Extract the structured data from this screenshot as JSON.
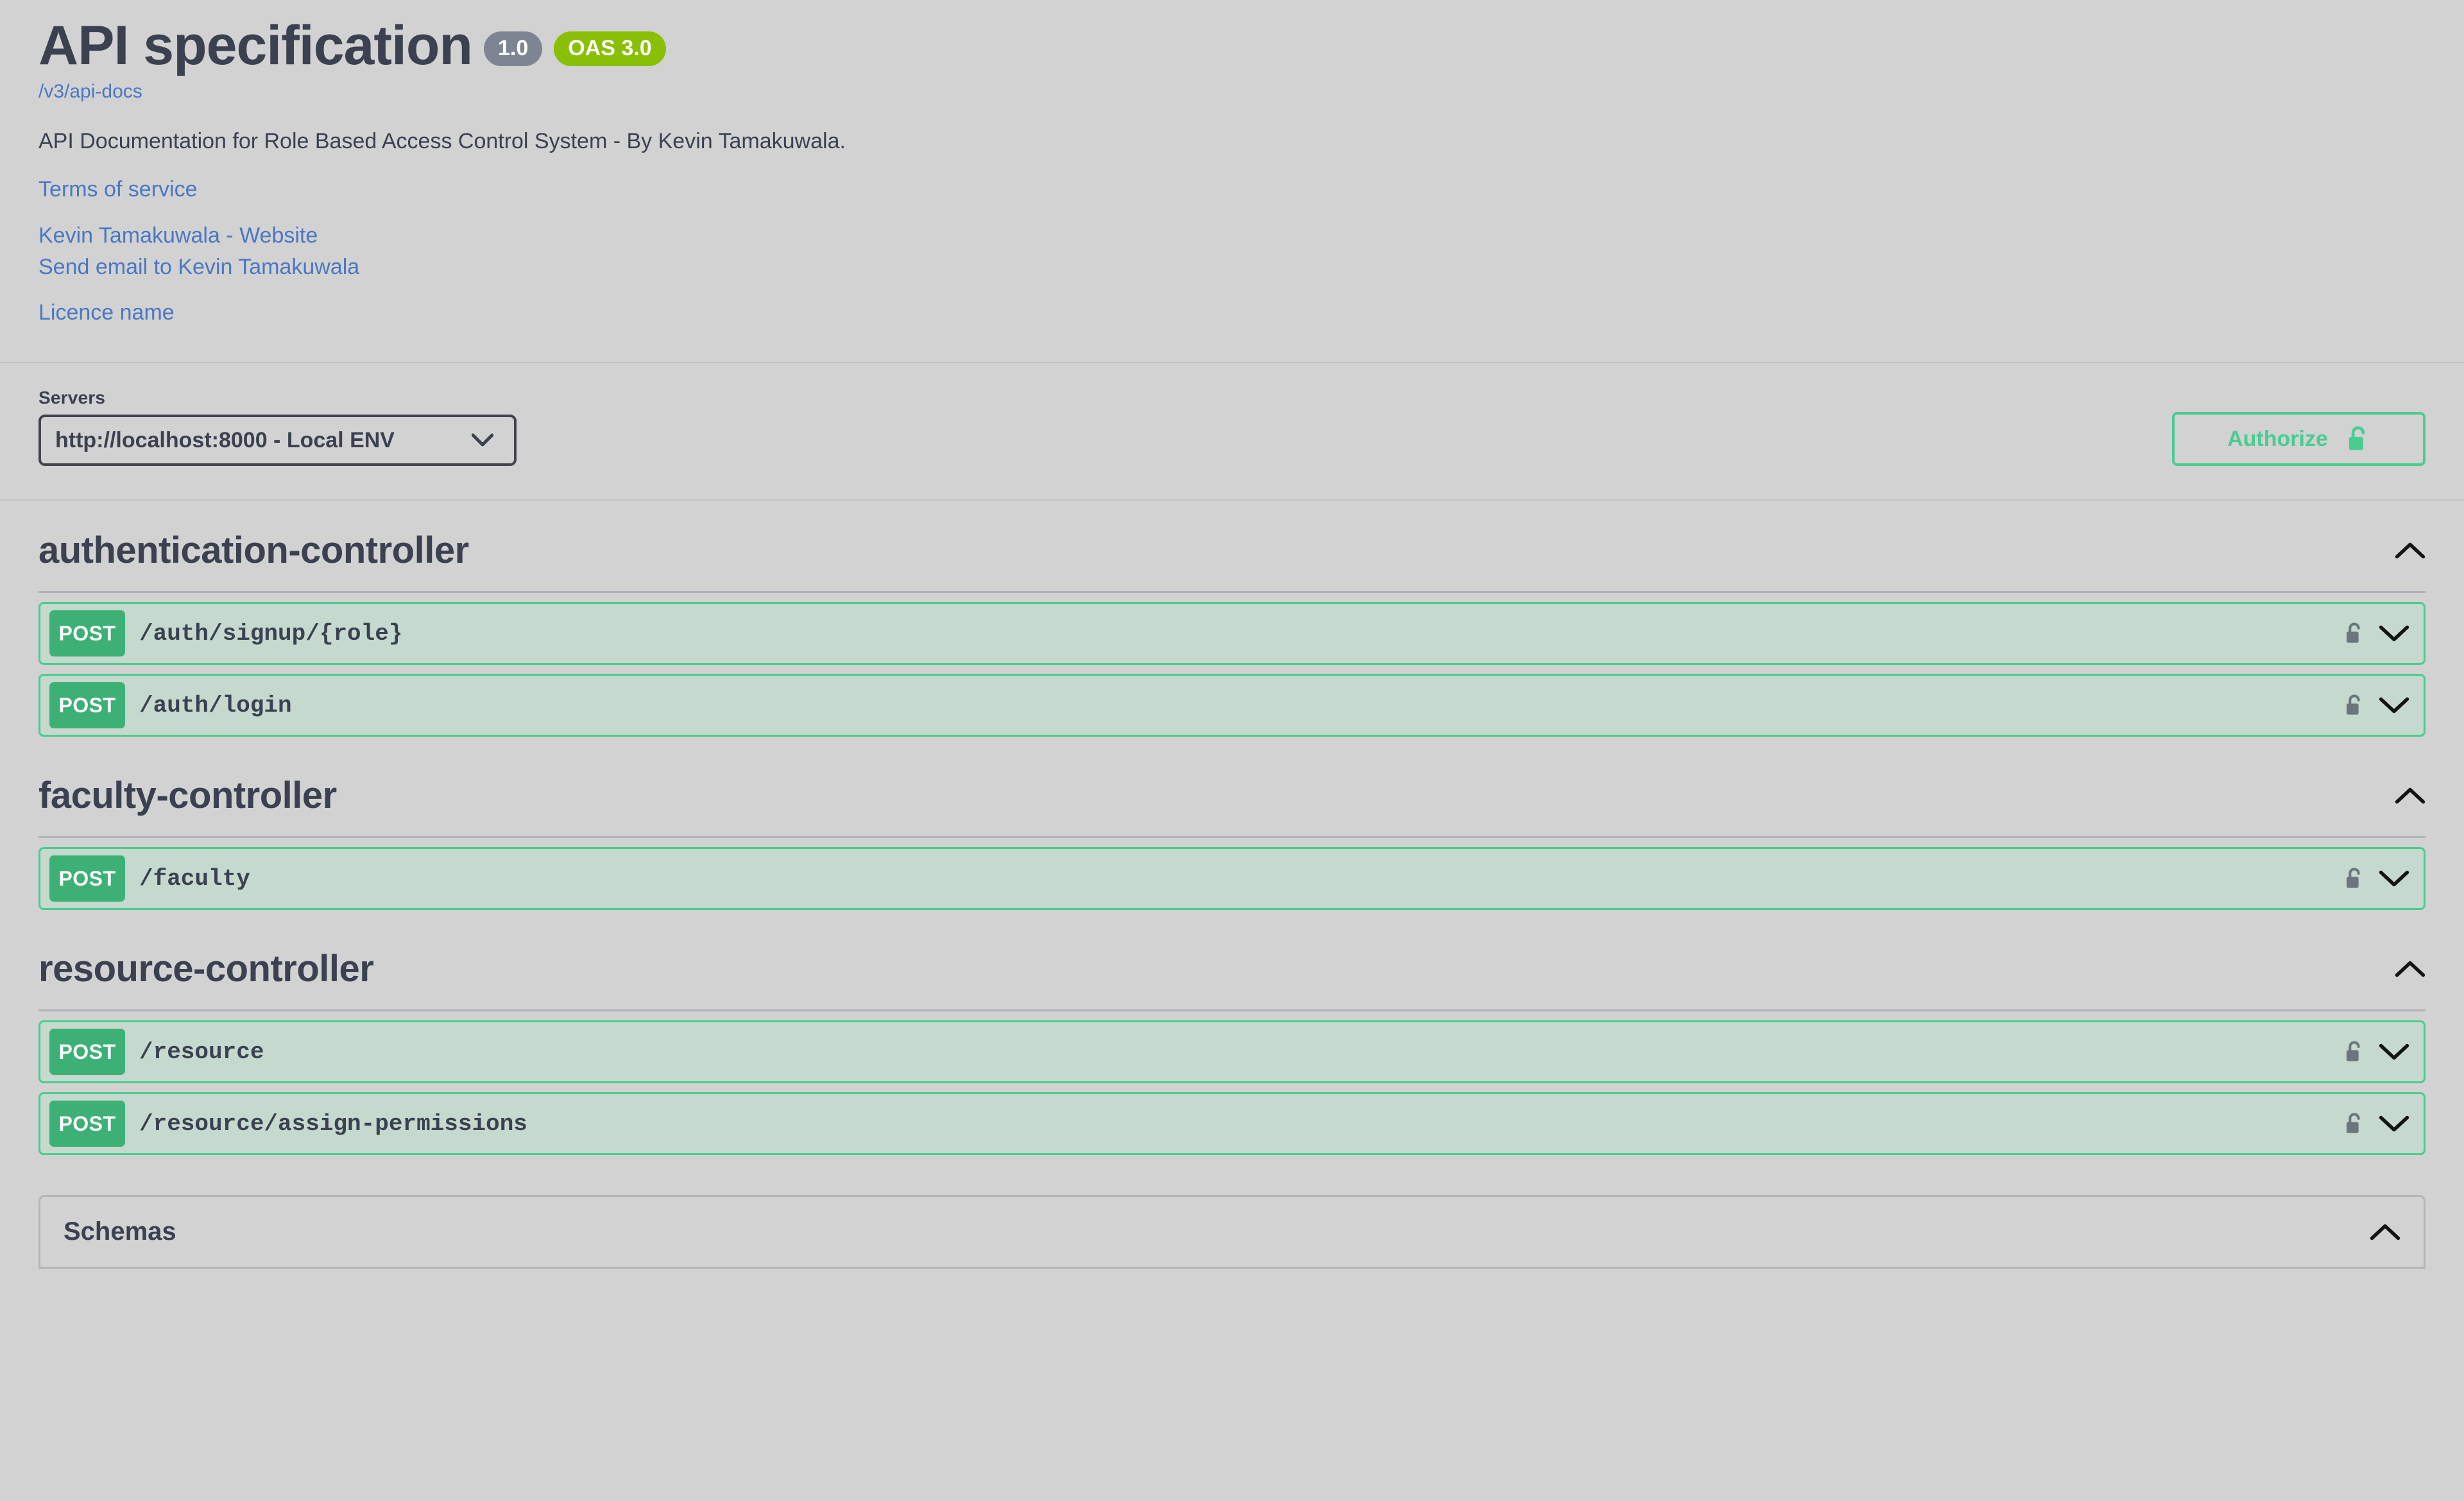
{
  "info": {
    "title": "API specification",
    "version_badge": "1.0",
    "oas_badge": "OAS 3.0",
    "docs_url": "/v3/api-docs",
    "description": "API Documentation for Role Based Access Control System - By Kevin Tamakuwala.",
    "links": {
      "terms": "Terms of service",
      "website": "Kevin Tamakuwala - Website",
      "email": "Send email to Kevin Tamakuwala",
      "licence": "Licence name"
    }
  },
  "servers": {
    "label": "Servers",
    "selected": "http://localhost:8000 - Local ENV",
    "options": [
      "http://localhost:8000 - Local ENV"
    ]
  },
  "authorize": {
    "label": "Authorize",
    "icon": "unlock-icon"
  },
  "sections": [
    {
      "tag": "authentication-controller",
      "toggle_icon": "chevron-up-icon",
      "operations": [
        {
          "method": "POST",
          "path": "/auth/signup/{role}",
          "lock_icon": "unlock-icon",
          "toggle_icon": "chevron-down-icon"
        },
        {
          "method": "POST",
          "path": "/auth/login",
          "lock_icon": "unlock-icon",
          "toggle_icon": "chevron-down-icon"
        }
      ]
    },
    {
      "tag": "faculty-controller",
      "toggle_icon": "chevron-up-icon",
      "operations": [
        {
          "method": "POST",
          "path": "/faculty",
          "lock_icon": "unlock-icon",
          "toggle_icon": "chevron-down-icon"
        }
      ]
    },
    {
      "tag": "resource-controller",
      "toggle_icon": "chevron-up-icon",
      "operations": [
        {
          "method": "POST",
          "path": "/resource",
          "lock_icon": "unlock-icon",
          "toggle_icon": "chevron-down-icon"
        },
        {
          "method": "POST",
          "path": "/resource/assign-permissions",
          "lock_icon": "unlock-icon",
          "toggle_icon": "chevron-down-icon"
        }
      ]
    }
  ],
  "models": {
    "title": "Schemas",
    "toggle_icon": "chevron-up-icon"
  },
  "colors": {
    "background": "#d2d2d2",
    "text": "#3b4151",
    "link": "#4a77c4",
    "post_green": "#49cc90",
    "post_badge": "#3db175",
    "opblock_bg": "#c5d9ce",
    "oas_badge": "#89bf04",
    "version_badge": "#7d8492"
  }
}
